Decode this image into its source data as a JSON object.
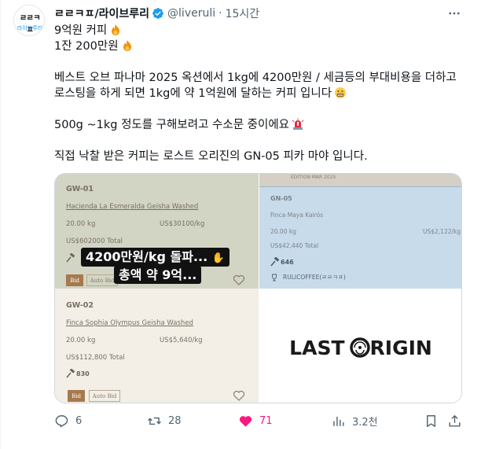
{
  "author": {
    "avatar_top": "ㄹㄹㅋㅍ",
    "avatar_bottom": "라이브루리",
    "name": "ㄹㄹㅋㅍ/라이브루리",
    "handle": "@liveruli",
    "separator": "·",
    "time": "15시간"
  },
  "body": {
    "line1": "9억원 커피",
    "line2": "1잔 200만원",
    "line3": "베스트 오브 파나마 2025 옥션에서 1kg에 4200만원 / 세금등의 부대비용을 더하고",
    "line4": "로스팅을 하게 되면 1kg에 약 1억원에 달하는 커피 입니다",
    "line5": "500g ~1kg 정도를 구해보려고 수소문 중이에요",
    "line6": "직접 낙찰 받은 커피는 로스트 오리진의 GN-05 피카 마야 입니다.",
    "emoji1": "fire-emoji",
    "emoji2": "fire-emoji",
    "emoji3": "grimacing-face-emoji",
    "emoji4": "police-light-emoji"
  },
  "media": {
    "lot1": {
      "code": "GW-01",
      "name": "Hacienda La Esmeralda Geisha Washed",
      "weight": "20.00 kg",
      "price_per_kg": "US$30100/kg",
      "total": "US$602000 Total",
      "bid_label": "Bid",
      "auto_bid_label": "Auto Bid"
    },
    "lot2": {
      "code": "GW-02",
      "name": "Finca Sophia Olympus Geisha Washed",
      "weight": "20.00 kg",
      "price_per_kg": "US$5,640/kg",
      "total": "US$112,800 Total",
      "bids": "830",
      "bid_label": "Bid",
      "auto_bid_label": "Auto Bid"
    },
    "lot3": {
      "band_text": "EDITION MAR 2025",
      "code": "GN-05",
      "name": "Finca Maya Kairós",
      "weight": "20.00 kg",
      "price_per_kg": "US$2,122/kg",
      "total": "US$42,440 Total",
      "bids": "646",
      "winner": "RULICOFFEE(ㄹㄹㅋㅍ)"
    },
    "overlay_line1": "4200만원/kg 돌파...",
    "overlay_line2": "총액 약 9억...",
    "logo_left": "LAST",
    "logo_right": "RIGIN"
  },
  "actions": {
    "replies": "6",
    "reposts": "28",
    "likes": "71",
    "views": "3.2천"
  },
  "colors": {
    "accent": "#1d9bf0",
    "like": "#f91880",
    "muted": "#536471"
  }
}
